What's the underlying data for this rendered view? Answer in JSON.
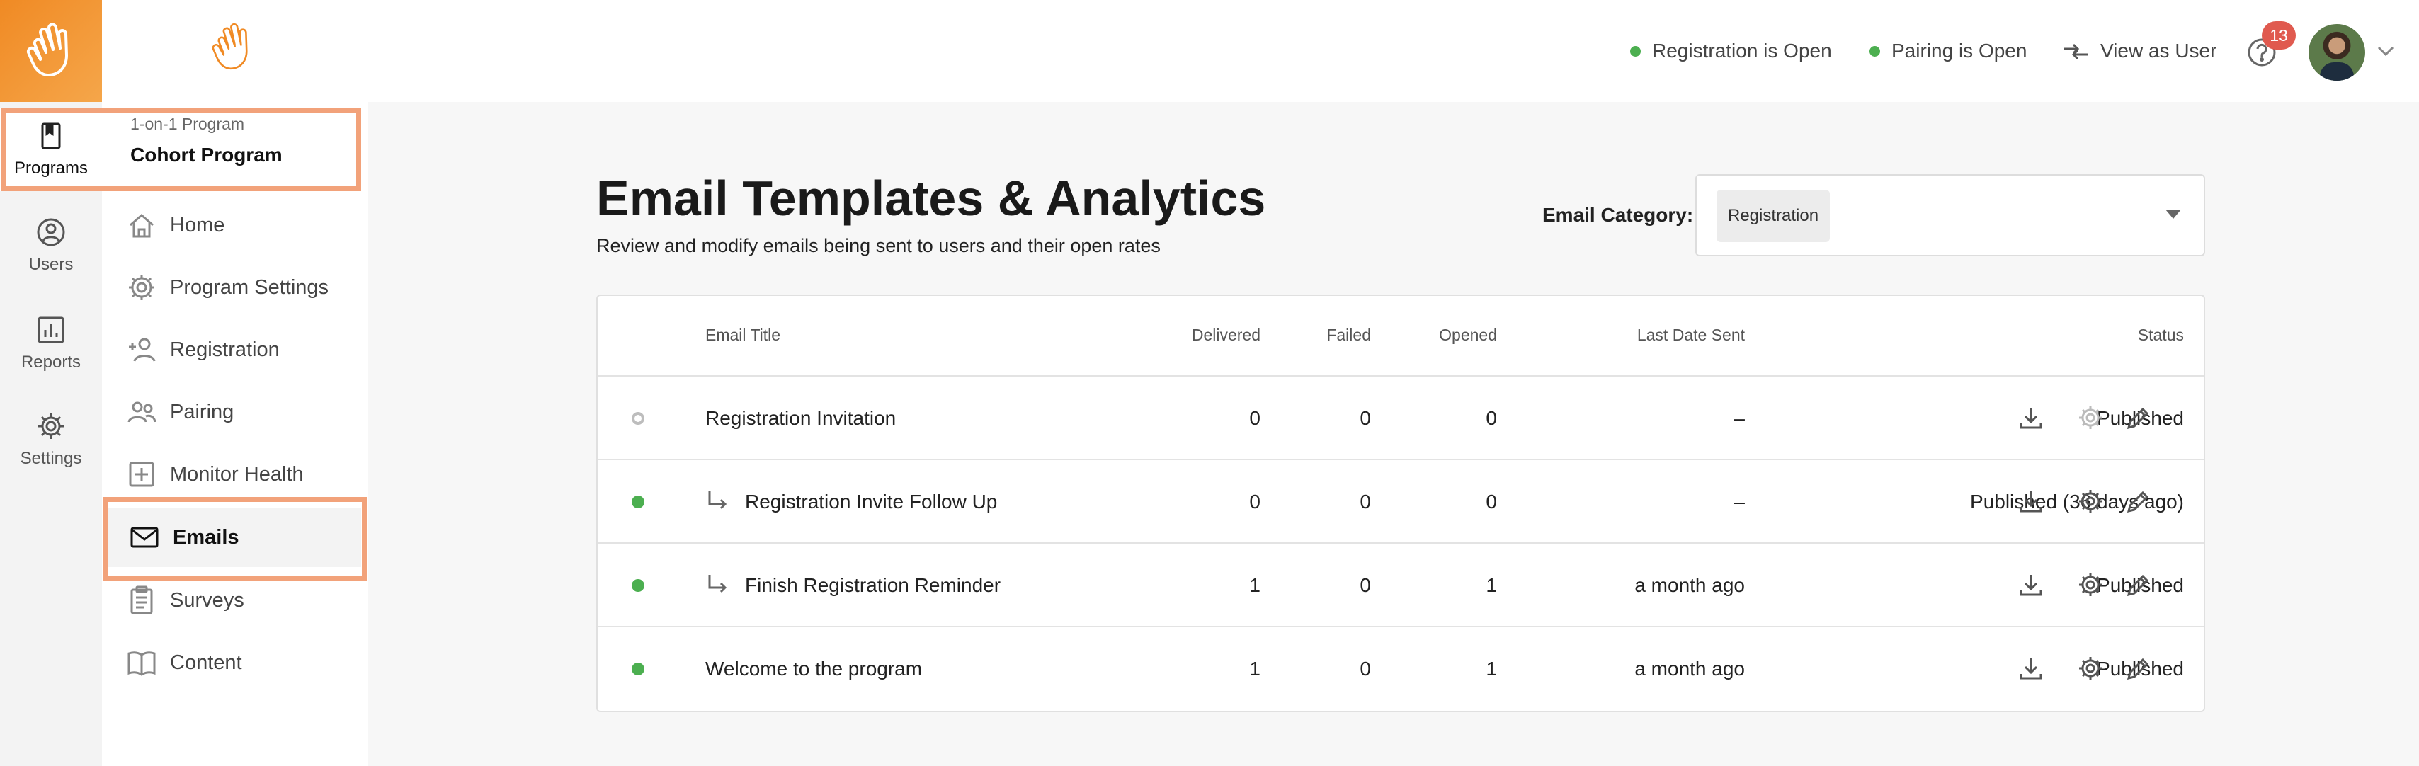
{
  "rail": {
    "items": [
      {
        "label": "Programs",
        "icon": "programs-icon"
      },
      {
        "label": "Users",
        "icon": "users-icon"
      },
      {
        "label": "Reports",
        "icon": "reports-icon"
      },
      {
        "label": "Settings",
        "icon": "settings-icon"
      }
    ]
  },
  "program": {
    "type": "1-on-1 Program",
    "name": "Cohort Program"
  },
  "nav": {
    "items": [
      {
        "label": "Home",
        "icon": "home-icon"
      },
      {
        "label": "Program Settings",
        "icon": "gear-icon"
      },
      {
        "label": "Registration",
        "icon": "add-person-icon"
      },
      {
        "label": "Pairing",
        "icon": "people-icon"
      },
      {
        "label": "Monitor Health",
        "icon": "plus-box-icon"
      },
      {
        "label": "Emails",
        "icon": "envelope-icon"
      },
      {
        "label": "Surveys",
        "icon": "clipboard-icon"
      },
      {
        "label": "Content",
        "icon": "book-icon"
      }
    ]
  },
  "topbar": {
    "registration_status": "Registration is Open",
    "pairing_status": "Pairing is Open",
    "view_as_user": "View as User",
    "notification_count": "13"
  },
  "page": {
    "title": "Email Templates & Analytics",
    "subtitle": "Review and modify emails being sent to users and their open rates",
    "category_label": "Email Category:",
    "category_value": "Registration"
  },
  "table": {
    "headers": {
      "title": "Email Title",
      "delivered": "Delivered",
      "failed": "Failed",
      "opened": "Opened",
      "last_sent": "Last Date Sent",
      "status": "Status"
    },
    "rows": [
      {
        "title": "Registration Invitation",
        "child": false,
        "active": false,
        "delivered": "0",
        "failed": "0",
        "opened": "0",
        "last_sent": "–",
        "status": "Published"
      },
      {
        "title": "Registration Invite Follow Up",
        "child": true,
        "active": true,
        "delivered": "0",
        "failed": "0",
        "opened": "0",
        "last_sent": "–",
        "status": "Published (36 days ago)"
      },
      {
        "title": "Finish Registration Reminder",
        "child": true,
        "active": true,
        "delivered": "1",
        "failed": "0",
        "opened": "1",
        "last_sent": "a month ago",
        "status": "Published"
      },
      {
        "title": "Welcome to the program",
        "child": false,
        "active": true,
        "delivered": "1",
        "failed": "0",
        "opened": "1",
        "last_sent": "a month ago",
        "status": "Published"
      }
    ]
  },
  "colors": {
    "accent": "#f08a24",
    "highlight": "#f2a27a",
    "active_dot": "#4caf50",
    "inactive_dot": "#bdbdbd"
  }
}
